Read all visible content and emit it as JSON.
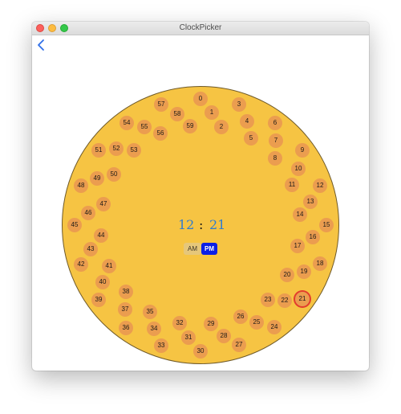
{
  "window": {
    "title": "ClockPicker"
  },
  "colors": {
    "clock_face": "#f6c443",
    "minute_button": "#eb9d4f",
    "selected_ring": "#e23d2d",
    "time_text": "#2f7cd0",
    "pm_selected": "#0b1fe6",
    "back_chevron": "#2f6fe8"
  },
  "icons": {
    "back": "chevron-left-icon"
  },
  "time": {
    "hour": "12",
    "separator": ":",
    "minute": "21"
  },
  "ampm": {
    "am_label": "AM",
    "pm_label": "PM",
    "selected": "PM"
  },
  "minutes": {
    "selected": "21",
    "labels": [
      "0",
      "1",
      "2",
      "3",
      "4",
      "5",
      "6",
      "7",
      "8",
      "9",
      "10",
      "11",
      "12",
      "13",
      "14",
      "15",
      "16",
      "17",
      "18",
      "19",
      "20",
      "21",
      "22",
      "23",
      "24",
      "25",
      "26",
      "27",
      "28",
      "29",
      "30",
      "31",
      "32",
      "33",
      "34",
      "35",
      "36",
      "37",
      "38",
      "39",
      "40",
      "41",
      "42",
      "43",
      "44",
      "45",
      "46",
      "47",
      "48",
      "49",
      "50",
      "51",
      "52",
      "53",
      "54",
      "55",
      "56",
      "57",
      "58",
      "59"
    ]
  }
}
